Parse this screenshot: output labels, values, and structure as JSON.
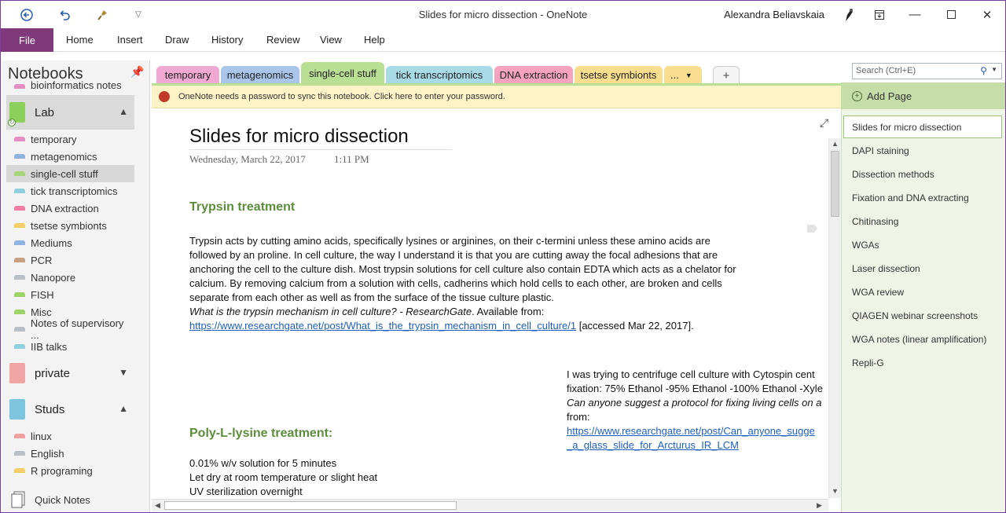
{
  "titlebar": {
    "title": "Slides for micro dissection  -  OneNote",
    "user": "Alexandra Beliavskaia"
  },
  "ribbon": {
    "file": "File",
    "tabs": [
      "Home",
      "Insert",
      "Draw",
      "History",
      "Review",
      "View",
      "Help"
    ]
  },
  "notebook_pane": {
    "header": "Notebooks",
    "cut_item": "bioinformatics notes",
    "notebooks": [
      {
        "name": "Lab",
        "color": "#8ccf5a",
        "expanded": true,
        "sections": [
          {
            "name": "temporary",
            "color": "#e58ec3"
          },
          {
            "name": "metagenomics",
            "color": "#8fb2e0"
          },
          {
            "name": "single-cell stuff",
            "color": "#a6d57a"
          },
          {
            "name": "tick transcriptomics",
            "color": "#8fd0dc"
          },
          {
            "name": "DNA extraction",
            "color": "#f07fa6"
          },
          {
            "name": "tsetse symbionts",
            "color": "#f3cf6a"
          },
          {
            "name": "Mediums",
            "color": "#8fb2e0"
          },
          {
            "name": "PCR",
            "color": "#c8a182"
          },
          {
            "name": "Nanopore",
            "color": "#b8bfc6"
          },
          {
            "name": "FISH",
            "color": "#9ed36a"
          },
          {
            "name": "Misc",
            "color": "#9ed36a"
          },
          {
            "name": "Notes of supervisory ...",
            "color": "#b8bfc6"
          },
          {
            "name": "IIB talks",
            "color": "#8fd0dc"
          }
        ]
      },
      {
        "name": "private",
        "color": "#f0a5a5",
        "expanded": false,
        "sections": []
      },
      {
        "name": "Studs",
        "color": "#7cc5dc",
        "expanded": true,
        "sections": [
          {
            "name": "linux",
            "color": "#f0a0a0"
          },
          {
            "name": "English",
            "color": "#b8bfc6"
          },
          {
            "name": "R programing",
            "color": "#f3cf6a"
          }
        ]
      }
    ],
    "quick_notes": "Quick Notes"
  },
  "section_tabs": [
    {
      "label": "temporary",
      "color": "#f1a9d3"
    },
    {
      "label": "metagenomics",
      "color": "#a9c6ea"
    },
    {
      "label": "single-cell stuff",
      "color": "#b8df94"
    },
    {
      "label": "tick transcriptomics",
      "color": "#a8dbe5"
    },
    {
      "label": "DNA extraction",
      "color": "#f6a3bf"
    },
    {
      "label": "tsetse symbionts",
      "color": "#f8de8e"
    }
  ],
  "section_tabs_more": "...",
  "infobar": {
    "text": "OneNote needs a password to sync this notebook. Click here to enter your password."
  },
  "page": {
    "title": "Slides for micro dissection",
    "date": "Wednesday, March 22, 2017",
    "time": "1:11 PM",
    "heading1": "Trypsin treatment",
    "body1": "Trypsin acts by cutting amino acids, specifically lysines or arginines, on their c-termini unless these amino acids are followed by an proline. In cell culture, the way I understand it is that you are cutting away the focal adhesions that are anchoring the cell to the culture dish. Most trypsin solutions for cell culture also contain EDTA which acts as a chelator for calcium. By removing calcium from a solution with cells, cadherins which hold cells to each other, are broken and cells separate from each other as well as from the surface of the tissue culture plastic.",
    "cite1_title": "What is the trypsin mechanism in cell culture? - ResearchGate",
    "cite1_avail": ". Available from:",
    "cite1_link": "https://www.researchgate.net/post/What_is_the_trypsin_mechanism_in_cell_culture/1",
    "cite1_accessed": " [accessed Mar 22, 2017].",
    "note2_line1": " I was trying to centrifuge cell culture with Cytospin cent",
    "note2_line2": "fixation: 75% Ethanol -95% Ethanol -100% Ethanol -Xyle",
    "note2_line3": "Can anyone suggest a protocol for fixing living cells on a",
    "note2_line4": "from:",
    "note2_link1": "https://www.researchgate.net/post/Can_anyone_sugge",
    "note2_link2": "_a_glass_slide_for_Arcturus_IR_LCM",
    "heading2": "Poly-L-lysine treatment:",
    "list2": [
      "0.01% w/v solution for 5 minutes",
      "Let dry at room temperature or slight heat",
      "UV sterilization overnight"
    ]
  },
  "pages_pane": {
    "search_placeholder": "Search (Ctrl+E)",
    "add_page": "Add Page",
    "pages": [
      "Slides for micro dissection",
      "DAPI staining",
      "Dissection methods",
      "Fixation and DNA extracting",
      "Chitinasing",
      "WGAs",
      "Laser dissection",
      "WGA review",
      "QIAGEN webinar screenshots",
      "WGA notes (linear amplification)",
      "Repli-G"
    ]
  },
  "colors": {
    "accent": "#80397b",
    "page_pane_bg": "#eef5e6",
    "add_page_bg": "#c5dea8",
    "heading_green": "#5c8c3c",
    "link_blue": "#1f5fbf"
  }
}
